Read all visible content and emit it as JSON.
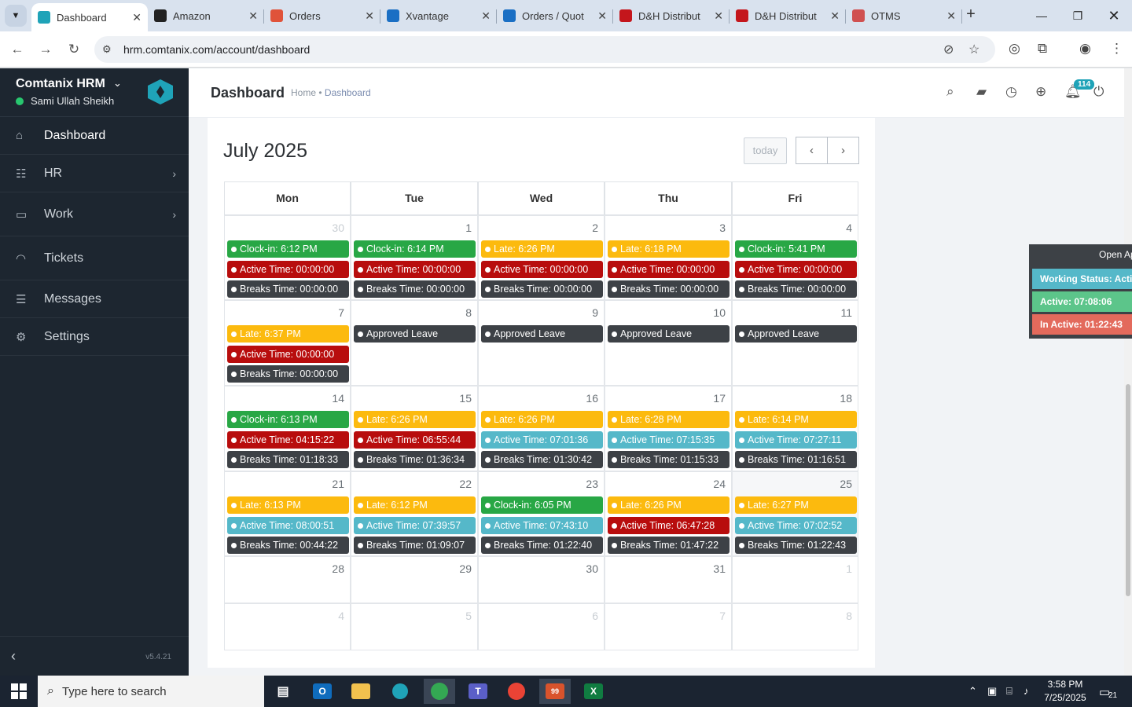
{
  "browser": {
    "tabs": [
      {
        "label": "Dashboard",
        "icon": "hrm-logo-icon",
        "color": "#1fa3b8",
        "active": true
      },
      {
        "label": "Amazon",
        "icon": "amazon-icon",
        "color": "#222222",
        "active": false
      },
      {
        "label": "Orders",
        "icon": "orders-icon",
        "color": "#e0533a",
        "active": false
      },
      {
        "label": "Xvantage",
        "icon": "xvantage-icon",
        "color": "#1a6fc4",
        "active": false
      },
      {
        "label": "Orders / Quot",
        "icon": "ec-icon",
        "color": "#1a6fc4",
        "active": false
      },
      {
        "label": "D&H Distribut",
        "icon": "dh-icon",
        "color": "#c4161c",
        "active": false
      },
      {
        "label": "D&H Distribut",
        "icon": "dh-icon",
        "color": "#c4161c",
        "active": false
      },
      {
        "label": "OTMS",
        "icon": "otms-icon",
        "color": "#d05050",
        "active": false
      }
    ],
    "url": "hrm.comtanix.com/account/dashboard"
  },
  "sidebar": {
    "app_name": "Comtanix HRM",
    "user_name": "Sami Ullah Sheikh",
    "items": [
      {
        "label": "Dashboard",
        "icon": "home-icon",
        "arrow": false,
        "active": true
      },
      {
        "label": "HR",
        "icon": "users-icon",
        "arrow": true,
        "active": false
      },
      {
        "label": "Work",
        "icon": "briefcase-icon",
        "arrow": true,
        "active": false
      },
      {
        "label": "Tickets",
        "icon": "headset-icon",
        "arrow": false,
        "active": false
      },
      {
        "label": "Messages",
        "icon": "message-icon",
        "arrow": false,
        "active": false
      },
      {
        "label": "Settings",
        "icon": "gear-icon",
        "arrow": false,
        "active": false
      }
    ],
    "version": "v5.4.21"
  },
  "header": {
    "title": "Dashboard",
    "breadcrumb_home": "Home",
    "breadcrumb_sep": "•",
    "breadcrumb_current": "Dashboard",
    "notification_count": "114"
  },
  "calendar": {
    "month_title": "July 2025",
    "today_label": "today",
    "weekdays": [
      "Mon",
      "Tue",
      "Wed",
      "Thu",
      "Fri"
    ],
    "weeks": [
      [
        {
          "day": "30",
          "other": true,
          "events": [
            {
              "text": "Clock-in: 6:12 PM",
              "color": "green"
            },
            {
              "text": "Active Time: 00:00:00",
              "color": "red"
            },
            {
              "text": "Breaks Time: 00:00:00",
              "color": "dark"
            }
          ]
        },
        {
          "day": "1",
          "other": false,
          "events": [
            {
              "text": "Clock-in: 6:14 PM",
              "color": "green"
            },
            {
              "text": "Active Time: 00:00:00",
              "color": "red"
            },
            {
              "text": "Breaks Time: 00:00:00",
              "color": "dark"
            }
          ]
        },
        {
          "day": "2",
          "other": false,
          "events": [
            {
              "text": "Late: 6:26 PM",
              "color": "yellow"
            },
            {
              "text": "Active Time: 00:00:00",
              "color": "red"
            },
            {
              "text": "Breaks Time: 00:00:00",
              "color": "dark"
            }
          ]
        },
        {
          "day": "3",
          "other": false,
          "events": [
            {
              "text": "Late: 6:18 PM",
              "color": "yellow"
            },
            {
              "text": "Active Time: 00:00:00",
              "color": "red"
            },
            {
              "text": "Breaks Time: 00:00:00",
              "color": "dark"
            }
          ]
        },
        {
          "day": "4",
          "other": false,
          "events": [
            {
              "text": "Clock-in: 5:41 PM",
              "color": "green"
            },
            {
              "text": "Active Time: 00:00:00",
              "color": "red"
            },
            {
              "text": "Breaks Time: 00:00:00",
              "color": "dark"
            }
          ]
        }
      ],
      [
        {
          "day": "7",
          "other": false,
          "events": [
            {
              "text": "Late: 6:37 PM",
              "color": "yellow"
            },
            {
              "text": "Active Time: 00:00:00",
              "color": "red"
            },
            {
              "text": "Breaks Time: 00:00:00",
              "color": "dark"
            }
          ]
        },
        {
          "day": "8",
          "other": false,
          "events": [
            {
              "text": "Approved Leave",
              "color": "dark"
            }
          ]
        },
        {
          "day": "9",
          "other": false,
          "events": [
            {
              "text": "Approved Leave",
              "color": "dark"
            }
          ]
        },
        {
          "day": "10",
          "other": false,
          "events": [
            {
              "text": "Approved Leave",
              "color": "dark"
            }
          ]
        },
        {
          "day": "11",
          "other": false,
          "events": [
            {
              "text": "Approved Leave",
              "color": "dark"
            }
          ]
        }
      ],
      [
        {
          "day": "14",
          "other": false,
          "events": [
            {
              "text": "Clock-in: 6:13 PM",
              "color": "green"
            },
            {
              "text": "Active Time: 04:15:22",
              "color": "red"
            },
            {
              "text": "Breaks Time: 01:18:33",
              "color": "dark"
            }
          ]
        },
        {
          "day": "15",
          "other": false,
          "events": [
            {
              "text": "Late: 6:26 PM",
              "color": "yellow"
            },
            {
              "text": "Active Time: 06:55:44",
              "color": "red"
            },
            {
              "text": "Breaks Time: 01:36:34",
              "color": "dark"
            }
          ]
        },
        {
          "day": "16",
          "other": false,
          "events": [
            {
              "text": "Late: 6:26 PM",
              "color": "yellow"
            },
            {
              "text": "Active Time: 07:01:36",
              "color": "teal"
            },
            {
              "text": "Breaks Time: 01:30:42",
              "color": "dark"
            }
          ]
        },
        {
          "day": "17",
          "other": false,
          "events": [
            {
              "text": "Late: 6:28 PM",
              "color": "yellow"
            },
            {
              "text": "Active Time: 07:15:35",
              "color": "teal"
            },
            {
              "text": "Breaks Time: 01:15:33",
              "color": "dark"
            }
          ]
        },
        {
          "day": "18",
          "other": false,
          "events": [
            {
              "text": "Late: 6:14 PM",
              "color": "yellow"
            },
            {
              "text": "Active Time: 07:27:11",
              "color": "teal"
            },
            {
              "text": "Breaks Time: 01:16:51",
              "color": "dark"
            }
          ]
        }
      ],
      [
        {
          "day": "21",
          "other": false,
          "events": [
            {
              "text": "Late: 6:13 PM",
              "color": "yellow"
            },
            {
              "text": "Active Time: 08:00:51",
              "color": "teal"
            },
            {
              "text": "Breaks Time: 00:44:22",
              "color": "dark"
            }
          ]
        },
        {
          "day": "22",
          "other": false,
          "events": [
            {
              "text": "Late: 6:12 PM",
              "color": "yellow"
            },
            {
              "text": "Active Time: 07:39:57",
              "color": "teal"
            },
            {
              "text": "Breaks Time: 01:09:07",
              "color": "dark"
            }
          ]
        },
        {
          "day": "23",
          "other": false,
          "events": [
            {
              "text": "Clock-in: 6:05 PM",
              "color": "green"
            },
            {
              "text": "Active Time: 07:43:10",
              "color": "teal"
            },
            {
              "text": "Breaks Time: 01:22:40",
              "color": "dark"
            }
          ]
        },
        {
          "day": "24",
          "other": false,
          "events": [
            {
              "text": "Late: 6:26 PM",
              "color": "yellow"
            },
            {
              "text": "Active Time: 06:47:28",
              "color": "red"
            },
            {
              "text": "Breaks Time: 01:47:22",
              "color": "dark"
            }
          ]
        },
        {
          "day": "25",
          "other": false,
          "today": true,
          "events": [
            {
              "text": "Late: 6:27 PM",
              "color": "yellow"
            },
            {
              "text": "Active Time: 07:02:52",
              "color": "teal"
            },
            {
              "text": "Breaks Time: 01:22:43",
              "color": "dark"
            }
          ]
        }
      ],
      [
        {
          "day": "28",
          "other": false,
          "events": []
        },
        {
          "day": "29",
          "other": false,
          "events": []
        },
        {
          "day": "30",
          "other": false,
          "events": []
        },
        {
          "day": "31",
          "other": false,
          "events": []
        },
        {
          "day": "1",
          "other": true,
          "events": []
        }
      ],
      [
        {
          "day": "4",
          "other": true,
          "events": []
        },
        {
          "day": "5",
          "other": true,
          "events": []
        },
        {
          "day": "6",
          "other": true,
          "events": []
        },
        {
          "day": "7",
          "other": true,
          "events": []
        },
        {
          "day": "8",
          "other": true,
          "events": []
        }
      ]
    ]
  },
  "status_panel": {
    "open_label": "Open Ap",
    "working_status": "Working Status: Acti",
    "active": "Active: 07:08:06",
    "inactive": "In Active: 01:22:43",
    "colors": {
      "working": "#55b8c9",
      "active": "#5cc58a",
      "inactive": "#e36a5c"
    }
  },
  "taskbar": {
    "search_placeholder": "Type here to search",
    "time": "3:58 PM",
    "date": "7/25/2025",
    "notif_count": "21",
    "zoom_badge": "99"
  }
}
